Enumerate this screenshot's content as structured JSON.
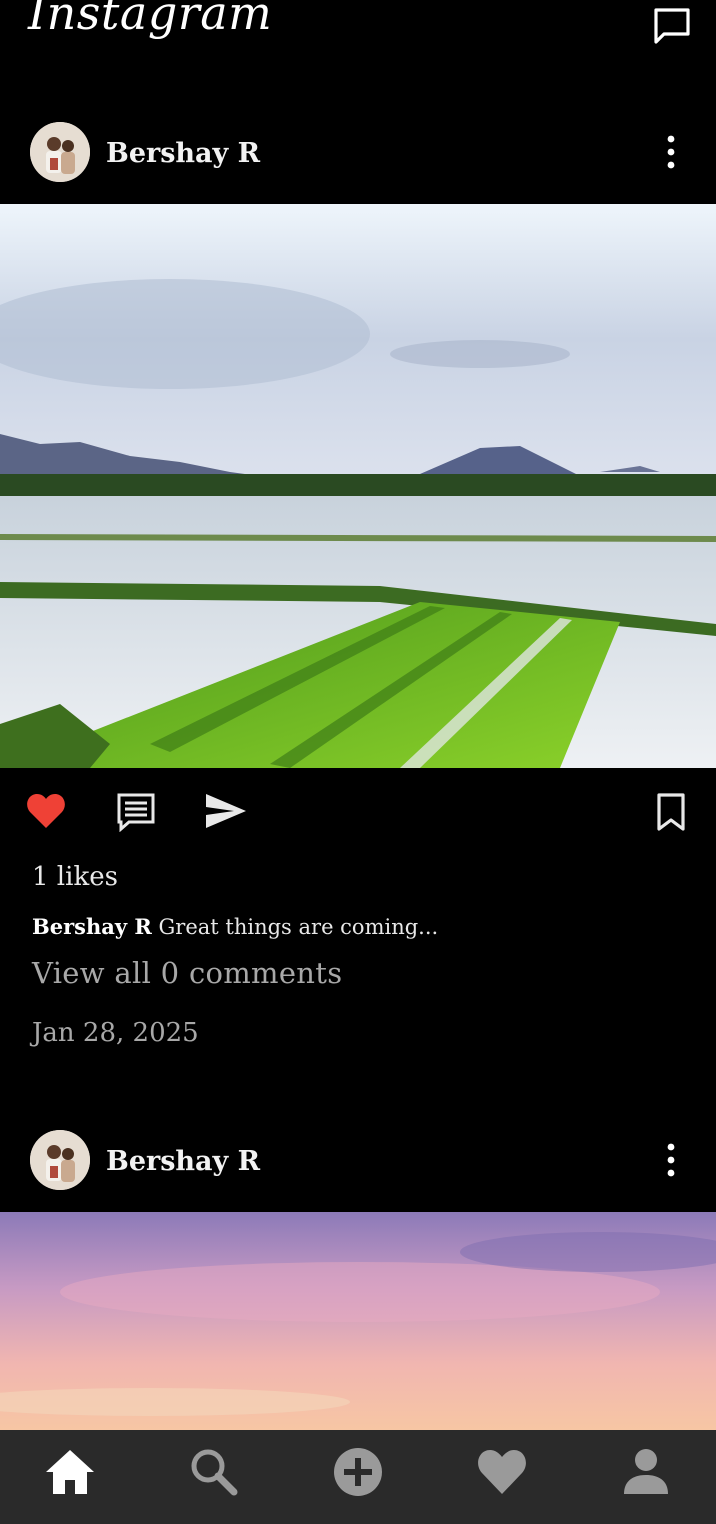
{
  "app": {
    "title": "Instagram"
  },
  "icons": {
    "messages": "message-square-icon",
    "more": "more-vertical-icon",
    "like": "heart-filled-icon",
    "comment": "comment-icon",
    "share": "send-icon",
    "save": "bookmark-icon",
    "nav_home": "home-icon",
    "nav_search": "search-icon",
    "nav_add": "add-circle-icon",
    "nav_activity": "heart-icon",
    "nav_profile": "person-icon"
  },
  "colors": {
    "background": "#000000",
    "like_active": "#ef4136",
    "nav_bar": "#2a2a2a"
  },
  "posts": [
    {
      "username": "Bershay R",
      "likes": "1 likes",
      "caption_user": "Bershay R",
      "caption_text": "Great things are coming...",
      "comments": "View all 0 comments",
      "date": "Jan 28, 2025",
      "liked": true
    },
    {
      "username": "Bershay R"
    }
  ]
}
